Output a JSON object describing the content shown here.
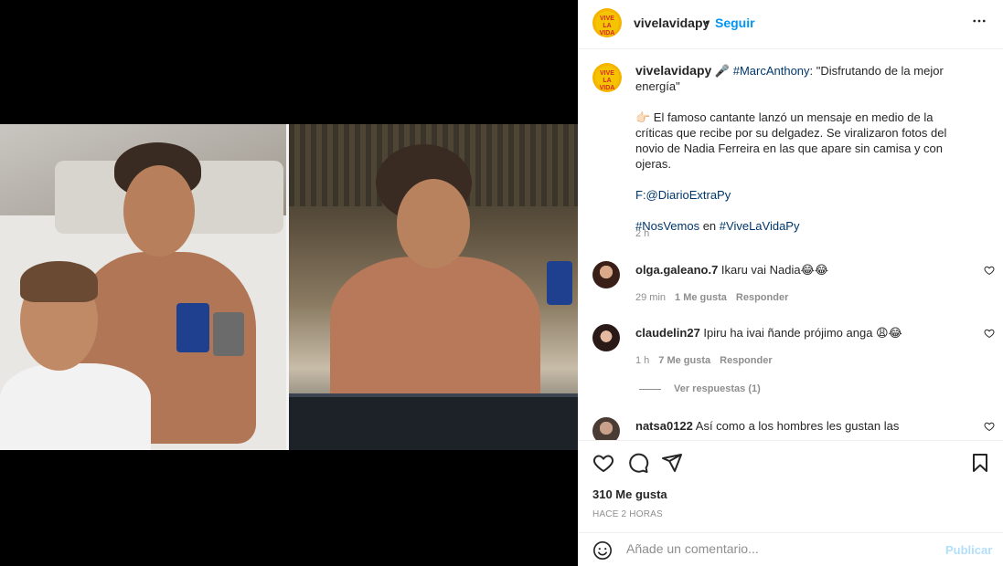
{
  "post": {
    "username": "vivelavidapy",
    "dot": "•",
    "follow_label": "Seguir",
    "more_icon": "more-horizontal-icon",
    "avatar_text": "VIVE LA VIDA"
  },
  "caption": {
    "username": "vivelavidapy",
    "mic_emoji": "🎤",
    "mention": "#MarcAnthony",
    "quote": ": \"Disfrutando de la mejor energía\"",
    "para2": "👉🏻 El famoso cantante lanzó un mensaje en medio de la críticas que recibe por su delgadez. Se viralizaron fotos del novio de Nadia Ferreira en las que apare sin camisa y con ojeras.",
    "source": "F:@DiarioExtraPy",
    "hashtag1": "#NosVemos",
    "en": " en ",
    "hashtag2": "#ViveLaVidaPy",
    "time": "2 h"
  },
  "comments": [
    {
      "username": "olga.galeano.7",
      "text": " Ikaru vai Nadia😂😂",
      "time": "29 min",
      "likes": "1 Me gusta",
      "reply": "Responder"
    },
    {
      "username": "claudelin27",
      "text": " Ipiru ha ivai ñande prójimo anga 😩😂",
      "time": "1 h",
      "likes": "7 Me gusta",
      "reply": "Responder"
    },
    {
      "username": "natsa0122",
      "text": " Así como a los hombres les gustan las"
    }
  ],
  "view_replies": "Ver respuestas (1)",
  "footer": {
    "likes": "310 Me gusta",
    "ago": "HACE 2 HORAS",
    "comment_placeholder": "Añade un comentario...",
    "publish": "Publicar"
  },
  "colors": {
    "link": "#0095f6",
    "hashtag": "#00376b",
    "muted": "#8e8e8e",
    "publish_disabled": "#b2dffc"
  }
}
